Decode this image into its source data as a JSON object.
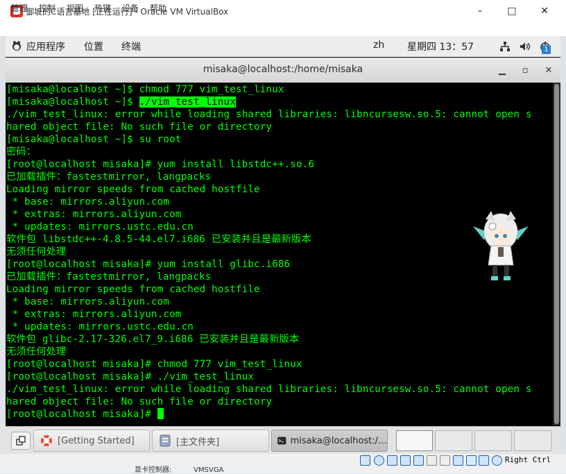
{
  "host_window": {
    "title": "御坂的C语言基地 [正在运行] - Oracle VM VirtualBox",
    "menu": [
      "管理",
      "控制",
      "视图",
      "热键",
      "设备",
      "帮助"
    ]
  },
  "guest_topbar": {
    "applications": "应用程序",
    "places": "位置",
    "terminal": "终端",
    "input_method": "zh",
    "clock": "星期四 13：57",
    "notification_badge": "1"
  },
  "terminal": {
    "title": "misaka@localhost:/home/misaka",
    "lines": [
      "[misaka@localhost ~]$ chmod 777 vim_test_linux",
      "[misaka@localhost ~]$ ",
      "./vim_test_linux: error while loading shared libraries: libncursesw.so.5: cannot open s",
      "hared object file: No such file or directory",
      "[misaka@localhost ~]$ su root",
      "密码：",
      "[root@localhost misaka]# yum install libstdc++.so.6",
      "已加载插件：fastestmirror, langpacks",
      "Loading mirror speeds from cached hostfile",
      " * base: mirrors.aliyun.com",
      " * extras: mirrors.aliyun.com",
      " * updates: mirrors.ustc.edu.cn",
      "软件包 libstdc++-4.8.5-44.el7.i686 已安装并且是最新版本",
      "无须任何处理",
      "[root@localhost misaka]# yum install glibc.i686",
      "已加载插件：fastestmirror, langpacks",
      "Loading mirror speeds from cached hostfile",
      " * base: mirrors.aliyun.com",
      " * extras: mirrors.aliyun.com",
      " * updates: mirrors.ustc.edu.cn",
      "软件包 glibc-2.17-326.el7_9.i686 已安装并且是最新版本",
      "无须任何处理",
      "[root@localhost misaka]# chmod 777 vim_test_linux",
      "[root@localhost misaka]# ./vim_test_linux",
      "./vim_test_linux: error while loading shared libraries: libncursesw.so.5: cannot open s",
      "hared object file: No such file or directory",
      "[root@localhost misaka]# "
    ],
    "highlighted_command": "./vim_test_linux",
    "text_color": "#00ff00",
    "background": "#000000"
  },
  "taskbar": {
    "items": [
      {
        "label": "[Getting Started]",
        "icon": "help-lifebuoy-icon"
      },
      {
        "label": "[主文件夹]",
        "icon": "folder-icon"
      },
      {
        "label": "misaka@localhost:/…",
        "icon": "terminal-icon"
      }
    ]
  },
  "vbox_status": {
    "host_key": "Right Ctrl",
    "underlay_label": "显卡控制器:",
    "underlay_value": "VMSVGA"
  }
}
